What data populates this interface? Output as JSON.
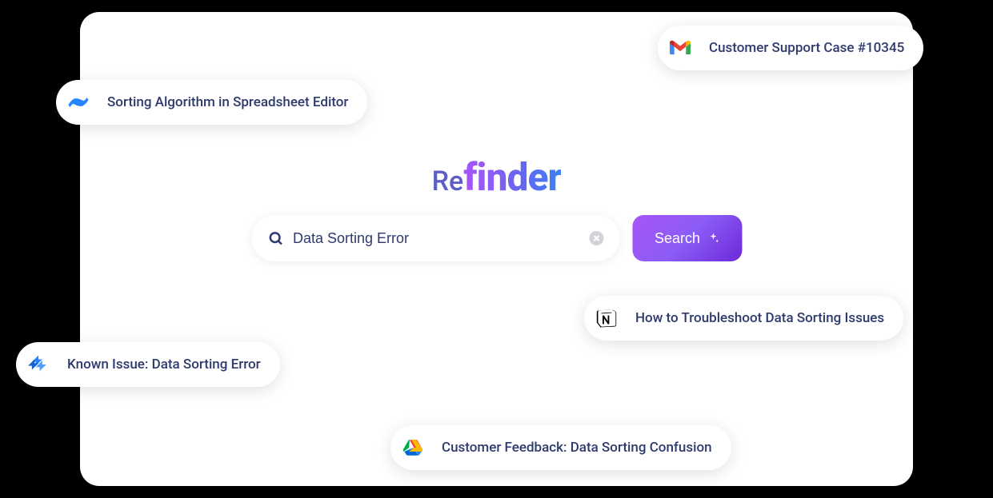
{
  "logo": {
    "prefix": "Re",
    "suffix": "finder"
  },
  "search": {
    "value": "Data Sorting Error",
    "button_label": "Search"
  },
  "results": [
    {
      "icon": "confluence",
      "label": "Sorting Algorithm in Spreadsheet Editor"
    },
    {
      "icon": "gmail",
      "label": "Customer Support Case #10345"
    },
    {
      "icon": "jira",
      "label": "Known Issue: Data Sorting Error"
    },
    {
      "icon": "notion",
      "label": "How to Troubleshoot Data Sorting Issues"
    },
    {
      "icon": "gdrive",
      "label": "Customer Feedback: Data Sorting Confusion"
    }
  ]
}
